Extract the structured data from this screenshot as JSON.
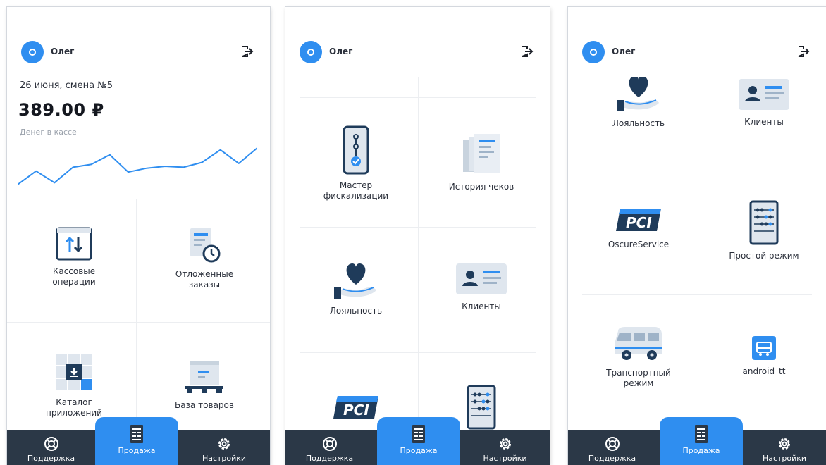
{
  "colors": {
    "accent": "#2f8ef0",
    "navbar": "#2b3847",
    "text": "#2a2f3a"
  },
  "user": {
    "name": "Олег",
    "avatar_icon": "user-avatar-icon",
    "logout_icon": "logout-icon"
  },
  "dashboard": {
    "shift": "26 июня, смена №5",
    "amount": "389.00 ₽",
    "amount_caption": "Денег в кассе",
    "trend": [
      8,
      22,
      10,
      26,
      29,
      39,
      21,
      25,
      27,
      26,
      31,
      44,
      30,
      46
    ]
  },
  "screen1": {
    "tiles": [
      {
        "label": "Кассовые\nоперации",
        "icon": "cash-operations-icon"
      },
      {
        "label": "Отложенные\nзаказы",
        "icon": "deferred-orders-icon"
      },
      {
        "label": "Каталог\nприложений",
        "icon": "app-catalog-icon"
      },
      {
        "label": "База товаров",
        "icon": "products-base-icon"
      }
    ]
  },
  "screen2": {
    "tiles": [
      {
        "label": "Мастер\nфискализации",
        "icon": "fiscal-wizard-icon"
      },
      {
        "label": "История чеков",
        "icon": "receipts-history-icon"
      },
      {
        "label": "Лояльность",
        "icon": "loyalty-icon"
      },
      {
        "label": "Клиенты",
        "icon": "clients-icon"
      },
      {
        "label": "",
        "icon": "pci-icon"
      },
      {
        "label": "",
        "icon": "abacus-icon"
      }
    ]
  },
  "screen3": {
    "tiles": [
      {
        "label": "Лояльность",
        "icon": "loyalty-icon"
      },
      {
        "label": "Клиенты",
        "icon": "clients-icon"
      },
      {
        "label": "OscureService",
        "icon": "pci-icon"
      },
      {
        "label": "Простой режим",
        "icon": "abacus-icon"
      },
      {
        "label": "Транспортный\nрежим",
        "icon": "bus-icon"
      },
      {
        "label": "android_tt",
        "icon": "android-tt-icon"
      }
    ]
  },
  "nav": {
    "support": "Поддержка",
    "sales": "Продажа",
    "settings": "Настройки"
  }
}
